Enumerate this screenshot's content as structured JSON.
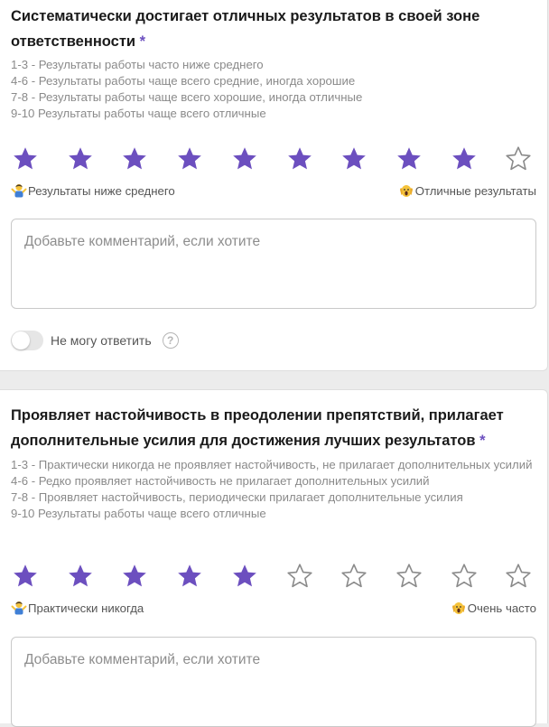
{
  "colors": {
    "accent": "#6c4fbf",
    "empty_star": "#8a8a8a"
  },
  "questions": [
    {
      "title": "Систематически достигает отличных результатов в своей зоне ответственности",
      "required_mark": "*",
      "scale": [
        "1-3 - Результаты работы часто ниже среднего",
        "4-6 - Результаты работы чаще всего средние, иногда хорошие",
        "7-8 - Результаты работы чаще всего хорошие, иногда отличные",
        "9-10 Результаты работы чаще всего отличные"
      ],
      "rating": {
        "value": 9,
        "max": 10
      },
      "min_label": "Результаты ниже среднего",
      "max_label": "Отличные результаты",
      "min_icon": "shrugging-person-icon",
      "max_icon": "screaming-face-icon",
      "comment_placeholder": "Добавьте комментарий, если хотите",
      "cant_answer_label": "Не могу ответить",
      "cant_answer_checked": false
    },
    {
      "title": "Проявляет настойчивость в преодолении препятствий, прилагает дополнительные усилия для достижения лучших результатов",
      "required_mark": "*",
      "scale": [
        "1-3 - Практически никогда не проявляет настойчивость, не прилагает дополнительных усилий",
        "4-6 - Редко проявляет настойчивость не прилагает дополнительных усилий",
        "7-8 - Проявляет настойчивость, периодически прилагает дополнительные усилия",
        "9-10 Результаты работы чаще всего отличные"
      ],
      "rating": {
        "value": 5,
        "max": 10
      },
      "min_label": "Практически никогда",
      "max_label": "Очень часто",
      "min_icon": "shrugging-person-icon",
      "max_icon": "screaming-face-icon",
      "comment_placeholder": "Добавьте комментарий, если хотите"
    }
  ],
  "help_glyph": "?"
}
